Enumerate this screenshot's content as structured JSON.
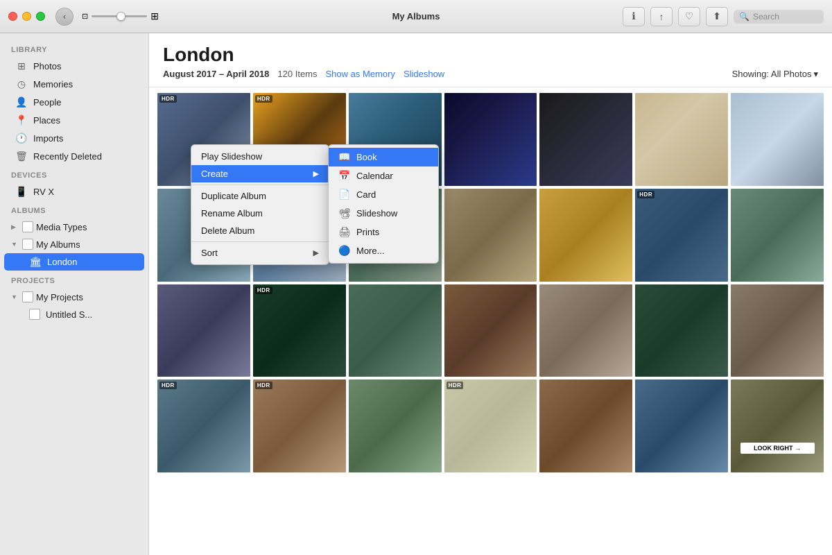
{
  "titleBar": {
    "title": "My Albums",
    "searchPlaceholder": "Search",
    "backButton": "‹",
    "buttons": {
      "info": "ℹ",
      "share": "↑",
      "heart": "♡",
      "export": "⬆"
    }
  },
  "sidebar": {
    "library_label": "Library",
    "devices_label": "Devices",
    "albums_label": "Albums",
    "projects_label": "Projects",
    "items": [
      {
        "id": "photos",
        "icon": "⬜",
        "label": "Photos"
      },
      {
        "id": "memories",
        "icon": "◷",
        "label": "Memories"
      },
      {
        "id": "people",
        "icon": "👤",
        "label": "People"
      },
      {
        "id": "places",
        "icon": "📍",
        "label": "Places"
      },
      {
        "id": "imports",
        "icon": "🕐",
        "label": "Imports"
      },
      {
        "id": "deleted",
        "icon": "🗑",
        "label": "Recently Deleted"
      }
    ],
    "devices": [
      {
        "id": "rvx",
        "icon": "📱",
        "label": "RV X"
      }
    ],
    "albums": [
      {
        "id": "mediatypes",
        "label": "Media Types",
        "expanded": false
      },
      {
        "id": "myalbums",
        "label": "My Albums",
        "expanded": true
      }
    ],
    "myAlbumsChildren": [
      {
        "id": "london",
        "label": "London",
        "selected": true
      }
    ],
    "projects": [
      {
        "id": "myprojects",
        "label": "My Projects",
        "expanded": true
      }
    ],
    "projectsChildren": [
      {
        "id": "untitled",
        "label": "Untitled S..."
      }
    ]
  },
  "content": {
    "title": "London",
    "dateRange": "August 2017 – April 2018",
    "itemCount": "120 Items",
    "showAsMemory": "Show as Memory",
    "slideshow": "Slideshow",
    "showing": "Showing: All Photos",
    "showingDropdown": "▾"
  },
  "contextMenu": {
    "items": [
      {
        "id": "play-slideshow",
        "label": "Play Slideshow",
        "hasArrow": false
      },
      {
        "id": "create",
        "label": "Create",
        "hasArrow": true,
        "highlighted": true
      },
      {
        "id": "duplicate",
        "label": "Duplicate Album",
        "hasArrow": false
      },
      {
        "id": "rename",
        "label": "Rename Album",
        "hasArrow": false
      },
      {
        "id": "delete",
        "label": "Delete Album",
        "hasArrow": false
      },
      {
        "id": "sort",
        "label": "Sort",
        "hasArrow": true
      }
    ]
  },
  "submenu": {
    "items": [
      {
        "id": "book",
        "icon": "📖",
        "label": "Book",
        "active": true
      },
      {
        "id": "calendar",
        "icon": "📅",
        "label": "Calendar"
      },
      {
        "id": "card",
        "icon": "📄",
        "label": "Card"
      },
      {
        "id": "slideshow",
        "icon": "📽",
        "label": "Slideshow"
      },
      {
        "id": "prints",
        "icon": "🖨",
        "label": "Prints"
      },
      {
        "id": "more",
        "icon": "🔵",
        "label": "More..."
      }
    ]
  },
  "photos": [
    {
      "id": 1,
      "class": "p1",
      "hdr": true
    },
    {
      "id": 2,
      "class": "p2",
      "hdr": true
    },
    {
      "id": 3,
      "class": "p3",
      "hdr": false
    },
    {
      "id": 4,
      "class": "p4",
      "hdr": false
    },
    {
      "id": 5,
      "class": "p5",
      "hdr": false
    },
    {
      "id": 6,
      "class": "p6",
      "hdr": false
    },
    {
      "id": 7,
      "class": "p7",
      "hdr": false
    },
    {
      "id": 8,
      "class": "p8",
      "hdr": false
    },
    {
      "id": 9,
      "class": "p9",
      "hdr": false
    },
    {
      "id": 10,
      "class": "p10",
      "hdr": false
    },
    {
      "id": 11,
      "class": "p11",
      "hdr": false
    },
    {
      "id": 12,
      "class": "p12",
      "hdr": false
    },
    {
      "id": 13,
      "class": "p13",
      "hdr": true
    },
    {
      "id": 14,
      "class": "p14",
      "hdr": false
    },
    {
      "id": 15,
      "class": "p15",
      "hdr": false
    },
    {
      "id": 16,
      "class": "p16",
      "hdr": false
    },
    {
      "id": 17,
      "class": "p17",
      "hdr": false
    },
    {
      "id": 18,
      "class": "p18",
      "hdr": false
    },
    {
      "id": 19,
      "class": "p19",
      "hdr": true
    },
    {
      "id": 20,
      "class": "p20",
      "hdr": false
    },
    {
      "id": 21,
      "class": "p21",
      "hdr": false
    },
    {
      "id": 22,
      "class": "p22",
      "hdr": true
    },
    {
      "id": 23,
      "class": "p23",
      "hdr": false
    },
    {
      "id": 24,
      "class": "p24",
      "hdr": false
    },
    {
      "id": 25,
      "class": "p25",
      "hdr": false
    },
    {
      "id": 26,
      "class": "p26",
      "hdr": true
    },
    {
      "id": 27,
      "class": "p27",
      "hdr": false
    },
    {
      "id": 28,
      "class": "p28",
      "hdr": false
    }
  ]
}
